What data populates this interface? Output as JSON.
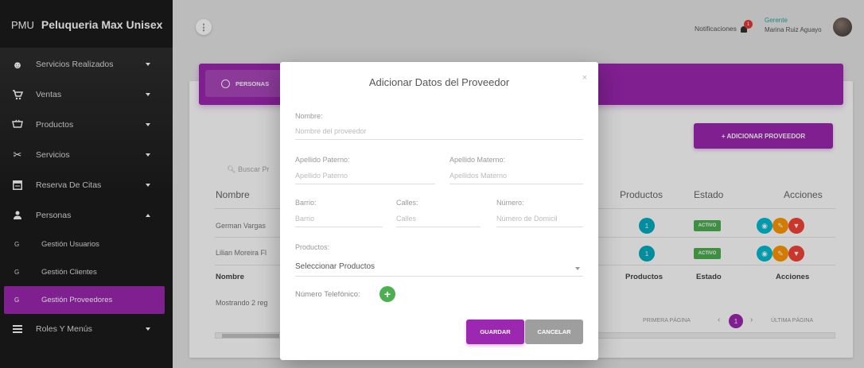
{
  "brand": {
    "abbr": "PMU",
    "name": "Peluqueria Max Unisex"
  },
  "sidebar": {
    "items": [
      {
        "label": "Servicios Realizados",
        "icon": "circle-face-icon"
      },
      {
        "label": "Ventas",
        "icon": "cart-icon"
      },
      {
        "label": "Productos",
        "icon": "basket-icon"
      },
      {
        "label": "Servicios",
        "icon": "scissors-icon"
      },
      {
        "label": "Reserva De Citas",
        "icon": "calendar-icon"
      },
      {
        "label": "Personas",
        "icon": "person-icon"
      }
    ],
    "subitems": [
      {
        "letter": "G",
        "label": "Gestión Usuarios"
      },
      {
        "letter": "G",
        "label": "Gestión Clientes"
      },
      {
        "letter": "G",
        "label": "Gestión Proveedores"
      }
    ],
    "last_item": {
      "label": "Roles Y Menús",
      "icon": "list-icon"
    }
  },
  "topbar": {
    "notifications_label": "Notificaciones",
    "notifications_count": "1",
    "user_role": "Gerente",
    "user_name": "Marina Ruiz Aguayo"
  },
  "content": {
    "tab_label": "PERSONAS",
    "add_button": "+ ADICIONAR PROVEEDOR",
    "search_placeholder": "Buscar Pr",
    "headers": {
      "nombre": "Nombre",
      "productos": "Productos",
      "estado": "Estado",
      "acciones": "Acciones"
    },
    "rows": [
      {
        "nombre": "German Vargas",
        "productos": "1",
        "estado": "ACTIVO"
      },
      {
        "nombre": "Lilian Moreira Fl",
        "productos": "1",
        "estado": "ACTIVO"
      }
    ],
    "footer_headers": {
      "nombre": "Nombre",
      "productos": "Productos",
      "estado": "Estado",
      "acciones": "Acciones"
    },
    "showing": "Mostrando 2 reg",
    "pager": {
      "first": "PRIMERA PÁGINA",
      "current": "1",
      "last": "ÚLTIMA PÁGINA"
    }
  },
  "modal": {
    "title": "Adicionar Datos del Proveedor",
    "close": "×",
    "nombre_label": "Nombre:",
    "nombre_placeholder": "Nombre del proveedor",
    "ap_paterno_label": "Apellido Paterno:",
    "ap_paterno_placeholder": "Apellido Paterno",
    "ap_materno_label": "Apellido Materno:",
    "ap_materno_placeholder": "Apellidos Materno",
    "barrio_label": "Barrio:",
    "barrio_placeholder": "Barrio",
    "calles_label": "Calles:",
    "calles_placeholder": "Calles",
    "numero_label": "Número:",
    "numero_placeholder": "Número de Domicil",
    "productos_label": "Productos:",
    "productos_select": "Seleccionar Productos",
    "telefono_label": "Número Telefónico:",
    "save": "GUARDAR",
    "cancel": "CANCELAR"
  },
  "colors": {
    "primary": "#9c27b0",
    "success": "#4caf50",
    "info": "#00acc1",
    "warning": "#ff9800",
    "danger": "#f44336"
  }
}
